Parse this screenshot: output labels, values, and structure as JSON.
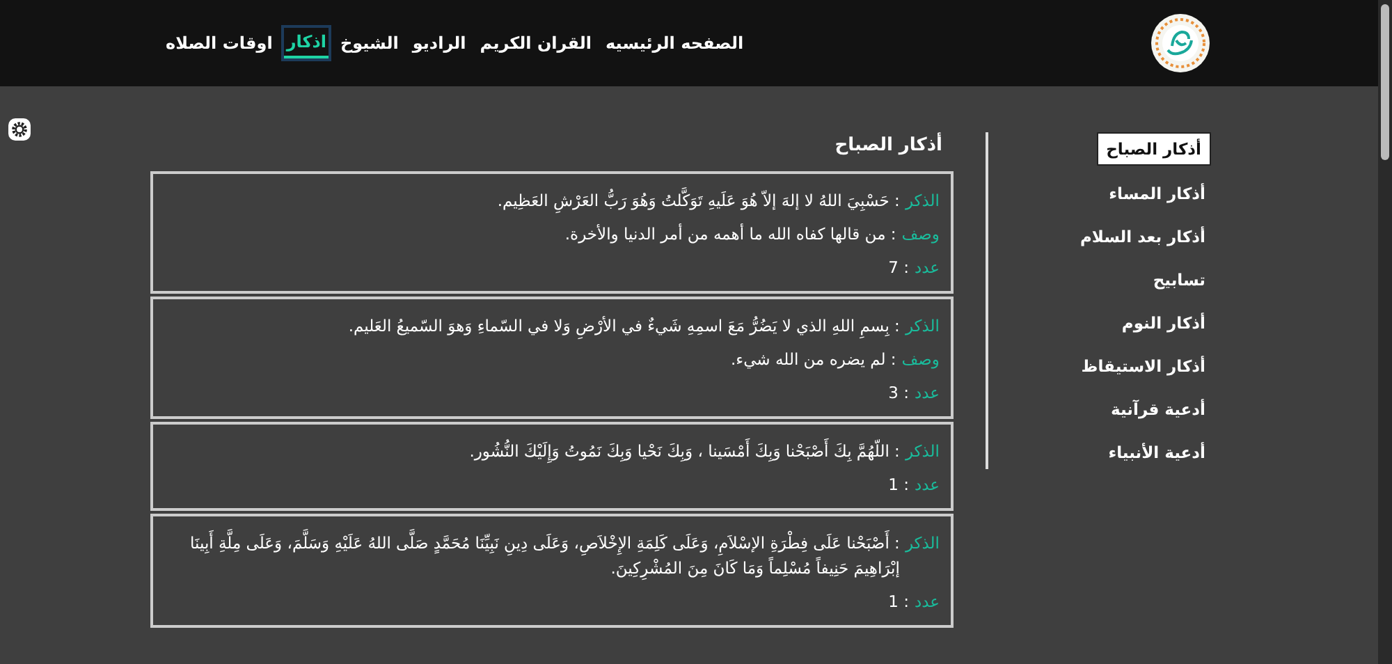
{
  "nav": {
    "items": [
      {
        "label": "الصفحه الرئيسيه",
        "selected": false
      },
      {
        "label": "القران الكريم",
        "selected": false
      },
      {
        "label": "الراديو",
        "selected": false
      },
      {
        "label": "الشيوخ",
        "selected": false
      },
      {
        "label": "اذكار",
        "selected": true
      },
      {
        "label": "اوقات الصلاه",
        "selected": false
      }
    ]
  },
  "sidebar": {
    "items": [
      {
        "label": "أذكار الصباح",
        "selected": true
      },
      {
        "label": "أذكار المساء",
        "selected": false
      },
      {
        "label": "أذكار بعد السلام",
        "selected": false
      },
      {
        "label": "تسابيح",
        "selected": false
      },
      {
        "label": "أذكار النوم",
        "selected": false
      },
      {
        "label": "أذكار الاستيقاظ",
        "selected": false
      },
      {
        "label": "أدعية قرآنية",
        "selected": false
      },
      {
        "label": "أدعية الأنبياء",
        "selected": false
      }
    ]
  },
  "content": {
    "heading": "أذكار الصباح",
    "cards": [
      {
        "lines": [
          {
            "label": "الذكر",
            "text": ": حَسْبِيَ اللهُ لا إلهَ إلاّ هُوَ عَلَيهِ تَوَكَّلتُ وَهُوَ رَبُّ العَرْشِ العَظِيم."
          },
          {
            "label": "وصف",
            "text": ": من قالها كفاه الله ما أهمه من أمر الدنيا والأخرة."
          },
          {
            "label": "عدد",
            "text": ": 7"
          }
        ]
      },
      {
        "lines": [
          {
            "label": "الذكر",
            "text": ": بِسمِ اللهِ الذي لا يَضُرُّ مَعَ اسمِهِ شَيءٌ في الأرْضِ وَلا في السّماءِ وَهوَ السّميعُ العَليم."
          },
          {
            "label": "وصف",
            "text": ": لم يضره من الله شيء."
          },
          {
            "label": "عدد",
            "text": ": 3"
          }
        ]
      },
      {
        "lines": [
          {
            "label": "الذكر",
            "text": ": اللّهُمَّ بِكَ أَصْبَحْنا وَبِكَ أَمْسَينا ، وَبِكَ نَحْيا وَبِكَ نَمُوتُ وَإِلَيْكَ النُّشُور."
          },
          {
            "label": "عدد",
            "text": ": 1"
          }
        ]
      },
      {
        "lines": [
          {
            "label": "الذكر",
            "text": ": أَصْبَحْنا عَلَى فِطْرَةِ الإسْلاَمِ، وَعَلَى كَلِمَةِ الإِخْلاَصِ، وَعَلَى دِينِ نَبِيِّنَا مُحَمَّدٍ صَلَّى اللهُ عَلَيْهِ وَسَلَّمَ، وَعَلَى مِلَّةِ أَبِينَا إبْرَاهِيمَ حَنِيفاً مُسْلِماً وَمَا كَانَ مِنَ المُشْرِكِينَ."
          },
          {
            "label": "عدد",
            "text": ": 1"
          }
        ]
      }
    ]
  }
}
